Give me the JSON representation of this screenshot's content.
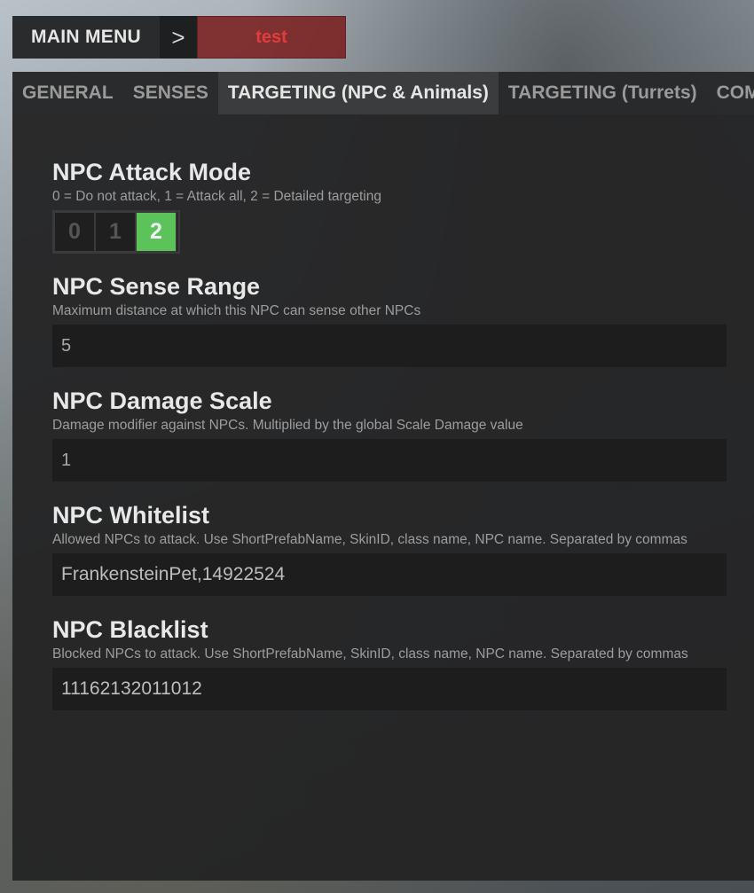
{
  "breadcrumb": {
    "main_menu_label": "MAIN MENU",
    "separator": ">",
    "current": "test"
  },
  "tabs": [
    {
      "label": "GENERAL",
      "active": false
    },
    {
      "label": "SENSES",
      "active": false
    },
    {
      "label": "TARGETING (NPC & Animals)",
      "active": true
    },
    {
      "label": "TARGETING (Turrets)",
      "active": false
    },
    {
      "label": "COMBA",
      "active": false
    }
  ],
  "sections": {
    "attack_mode": {
      "title": "NPC Attack Mode",
      "description": "0 = Do not attack, 1 = Attack all, 2 = Detailed targeting",
      "options": [
        "0",
        "1",
        "2"
      ],
      "selected": "2"
    },
    "sense_range": {
      "title": "NPC Sense Range",
      "description": "Maximum distance at which this NPC can sense other NPCs",
      "value": "5"
    },
    "damage_scale": {
      "title": "NPC Damage Scale",
      "description": "Damage modifier against NPCs. Multiplied by the global Scale Damage value",
      "value": "1"
    },
    "whitelist": {
      "title": "NPC Whitelist",
      "description": "Allowed NPCs to attack. Use ShortPrefabName, SkinID, class name, NPC name. Separated by commas",
      "value": "FrankensteinPet,14922524"
    },
    "blacklist": {
      "title": "NPC Blacklist",
      "description": "Blocked NPCs to attack. Use ShortPrefabName, SkinID, class name, NPC name. Separated by commas",
      "value": "11162132011012"
    }
  },
  "colors": {
    "selected_mode": "#5cc25a",
    "breadcrumb_current_bg": "#7a1f1f",
    "breadcrumb_current_text": "#e23c3c"
  }
}
